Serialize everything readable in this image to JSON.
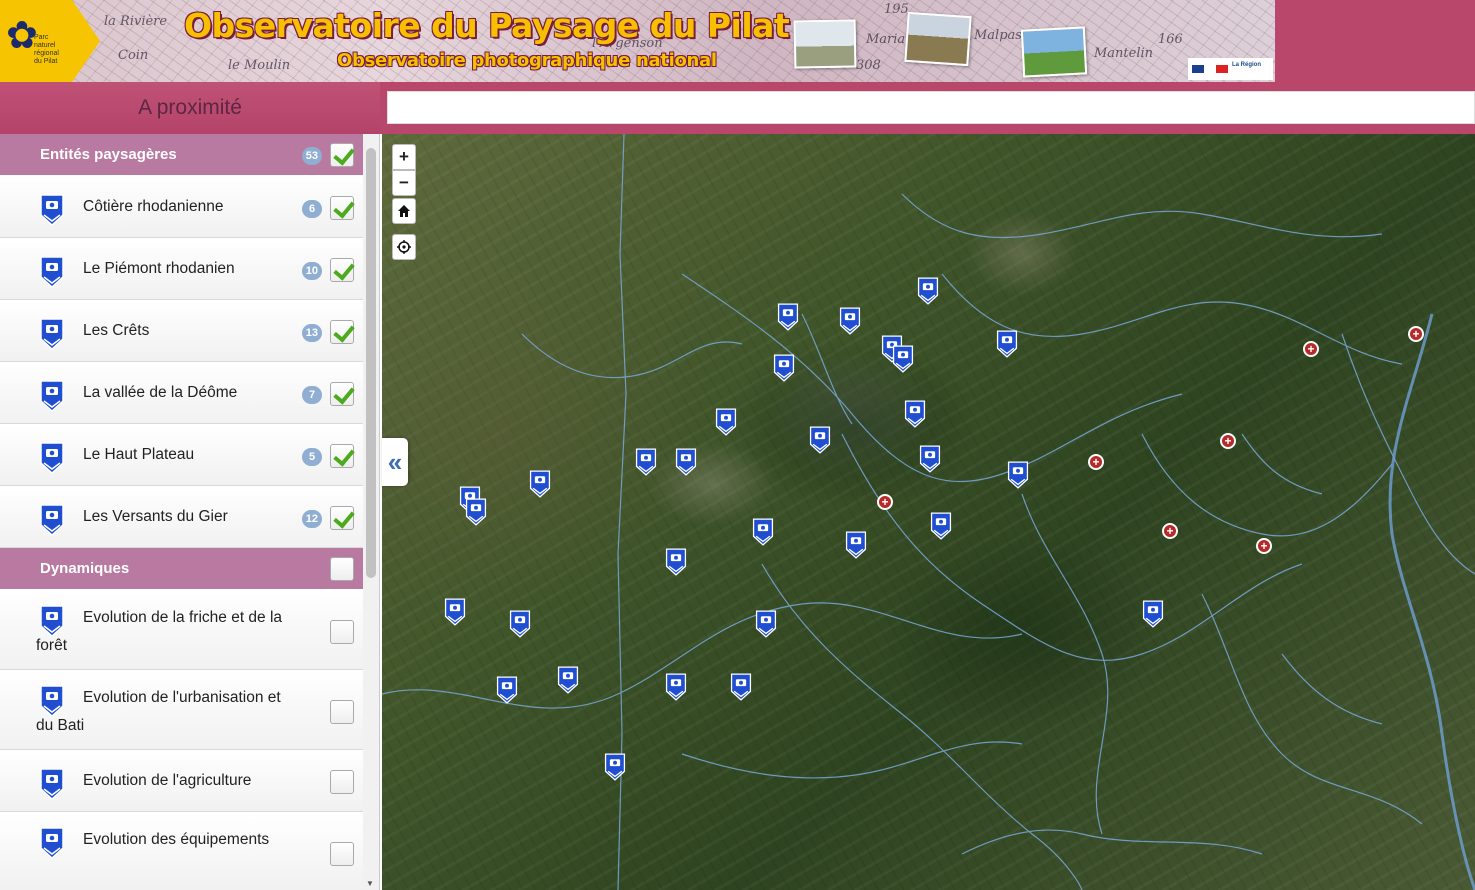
{
  "header": {
    "title": "Observatoire du Paysage du Pilat",
    "subtitle": "Observatoire photographique national",
    "logo_text": "Parc naturel régional du Pilat",
    "map_place_names": [
      "la Rivière",
      "Coin",
      "le Moulin",
      "l'Argenson",
      "Maria",
      "Malpas",
      "Mantelin",
      "195",
      "166",
      "308"
    ],
    "partner_region_label": "La Région"
  },
  "toolbar": {
    "nearby_label": "A proximité",
    "search_value": "",
    "search_placeholder": ""
  },
  "sidebar": {
    "groups": [
      {
        "label": "Entités paysagères",
        "count": "53",
        "checked": true,
        "items": [
          {
            "label": "Côtière rhodanienne",
            "count": "6",
            "checked": true
          },
          {
            "label": "Le Piémont rhodanien",
            "count": "10",
            "checked": true
          },
          {
            "label": "Les Crêts",
            "count": "13",
            "checked": true
          },
          {
            "label": "La vallée de la Déôme",
            "count": "7",
            "checked": true
          },
          {
            "label": "Le Haut Plateau",
            "count": "5",
            "checked": true
          },
          {
            "label": "Les Versants du Gier",
            "count": "12",
            "checked": true
          }
        ]
      },
      {
        "label": "Dynamiques",
        "checked": false,
        "items": [
          {
            "label": "Evolution de la friche et de la forêt",
            "checked": false
          },
          {
            "label": "Evolution de l'urbanisation et du Bati",
            "checked": false
          },
          {
            "label": "Evolution de l'agriculture",
            "checked": false
          },
          {
            "label": "Evolution des équipements",
            "checked": false
          }
        ]
      }
    ]
  },
  "map_controls": {
    "zoom_in": "+",
    "zoom_out": "−",
    "collapse": "«"
  },
  "colors": {
    "brand": "#b9476c",
    "group_header": "#b87aa1",
    "badge": "#8faed2",
    "marker_blue": "#1f4fd0",
    "marker_plus": "#b62a2a",
    "title_yellow": "#f6c000"
  },
  "icons": {
    "layer_pin": "camera-pin-icon",
    "home": "home-icon",
    "locate": "locate-icon",
    "collapse": "double-chevron-left-icon"
  }
}
